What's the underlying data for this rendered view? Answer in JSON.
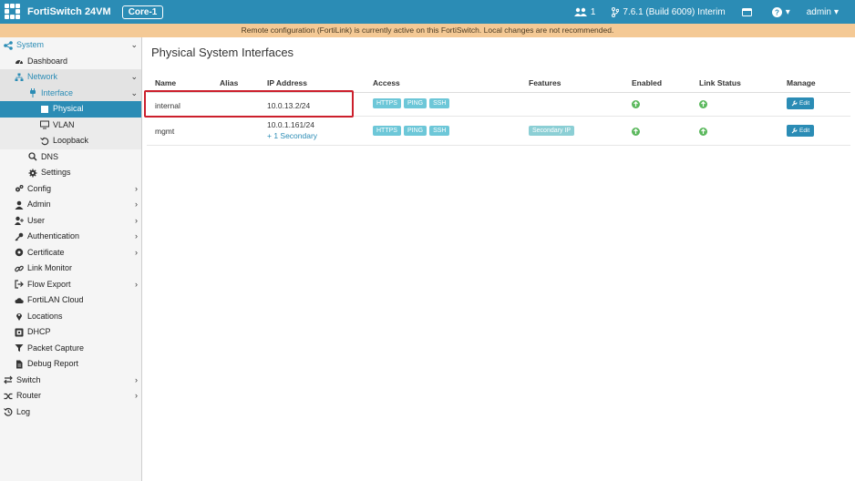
{
  "topbar": {
    "app_title": "FortiSwitch 24VM",
    "hostname": "Core-1",
    "users_count": "1",
    "version": "7.6.1 (Build 6009) Interim",
    "user": "admin",
    "help_caret": "▾",
    "user_caret": "▾"
  },
  "banner": {
    "message": "Remote configuration (FortiLink) is currently active on this FortiSwitch. Local changes are not recommended."
  },
  "sidebar": {
    "system": "System",
    "dashboard": "Dashboard",
    "network": "Network",
    "interface": "Interface",
    "physical": "Physical",
    "vlan": "VLAN",
    "loopback": "Loopback",
    "dns": "DNS",
    "settings": "Settings",
    "config": "Config",
    "admin": "Admin",
    "user": "User",
    "authentication": "Authentication",
    "certificate": "Certificate",
    "link_monitor": "Link Monitor",
    "flow_export": "Flow Export",
    "fortilan_cloud": "FortiLAN Cloud",
    "locations": "Locations",
    "dhcp": "DHCP",
    "packet_capture": "Packet Capture",
    "debug_report": "Debug Report",
    "switch": "Switch",
    "router": "Router",
    "log": "Log",
    "chev_down": "⌄",
    "chev_right": "›"
  },
  "main": {
    "title": "Physical System Interfaces",
    "columns": {
      "name": "Name",
      "alias": "Alias",
      "ip": "IP Address",
      "access": "Access",
      "features": "Features",
      "enabled": "Enabled",
      "link_status": "Link Status",
      "manage": "Manage"
    },
    "rows": [
      {
        "name": "internal",
        "alias": "",
        "ip": "10.0.13.2/24",
        "access": [
          "HTTPS",
          "PING",
          "SSH"
        ],
        "feature": "",
        "edit": "Edit"
      },
      {
        "name": "mgmt",
        "alias": "",
        "ip": "10.0.1.161/24",
        "secondary": "+ 1 Secondary",
        "access": [
          "HTTPS",
          "PING",
          "SSH"
        ],
        "feature": "Secondary IP",
        "edit": "Edit"
      }
    ]
  },
  "colors": {
    "brand": "#2b8cb5",
    "banner": "#f4c995",
    "status_up": "#5bb85d",
    "highlight": "#cc1f2c"
  },
  "icons": {
    "logo": "fortinet-logo-icon",
    "users": "users-icon",
    "version": "git-branch-icon",
    "console": "console-icon",
    "help": "help-icon"
  }
}
